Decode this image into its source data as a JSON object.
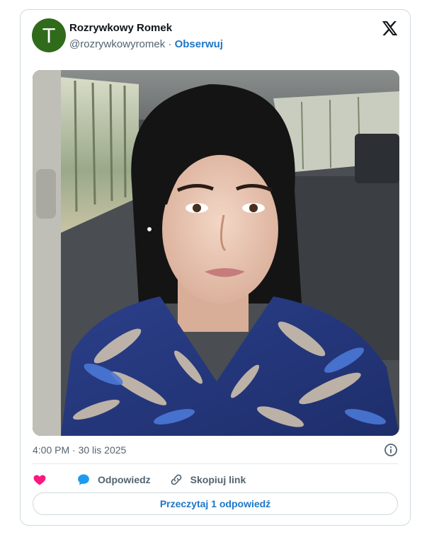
{
  "tweet": {
    "author": {
      "avatar_letter": "T",
      "avatar_color": "#2f6b1b",
      "name": "Rozrywkowy Romek",
      "handle": "@rozrywkowyromek",
      "separator": "·",
      "follow_label": "Obserwuj"
    },
    "timestamp": "4:00 PM · 30 lis 2025",
    "actions": {
      "like_icon": "heart-icon",
      "reply_label": "Odpowiedz",
      "reply_icon": "speech-bubble-icon",
      "copy_link_label": "Skopiuj link",
      "copy_link_icon": "link-icon"
    },
    "read_replies_label": "Przeczytaj 1 odpowiedź"
  },
  "colors": {
    "link_blue": "#1d77c8",
    "heart_pink": "#f91880",
    "reply_blue": "#1d9bf0",
    "muted_text": "#536471",
    "border": "#cfd9de"
  }
}
